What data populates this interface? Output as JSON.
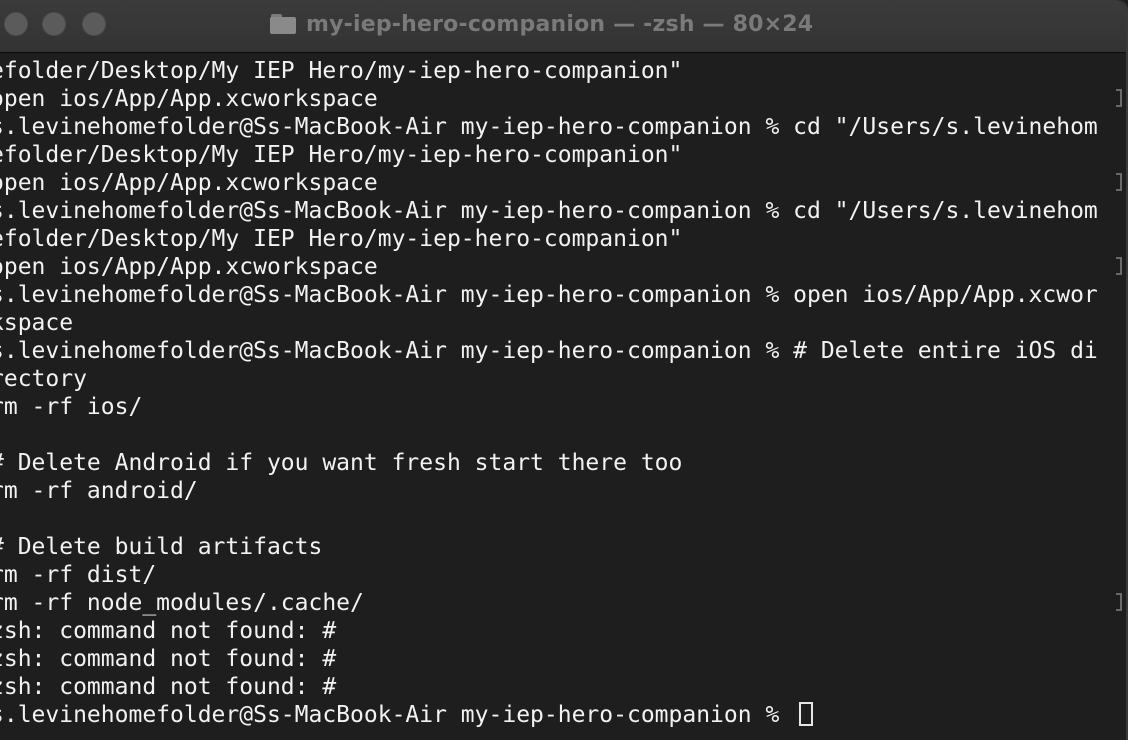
{
  "window": {
    "title": "my-iep-hero-companion — -zsh — 80×24",
    "folder_icon": "folder-icon"
  },
  "terminal": {
    "lines": [
      "efolder/Desktop/My IEP Hero/my-iep-hero-companion\"",
      "open ios/App/App.xcworkspace",
      "s.levinehomefolder@Ss-MacBook-Air my-iep-hero-companion % cd \"/Users/s.levinehom",
      "efolder/Desktop/My IEP Hero/my-iep-hero-companion\"",
      "open ios/App/App.xcworkspace",
      "s.levinehomefolder@Ss-MacBook-Air my-iep-hero-companion % cd \"/Users/s.levinehom",
      "efolder/Desktop/My IEP Hero/my-iep-hero-companion\"",
      "open ios/App/App.xcworkspace",
      "s.levinehomefolder@Ss-MacBook-Air my-iep-hero-companion % open ios/App/App.xcwor",
      "kspace",
      "s.levinehomefolder@Ss-MacBook-Air my-iep-hero-companion % # Delete entire iOS di",
      "rectory",
      "rm -rf ios/",
      "",
      "# Delete Android if you want fresh start there too",
      "rm -rf android/",
      "",
      "# Delete build artifacts",
      "rm -rf dist/",
      "rm -rf node_modules/.cache/",
      "zsh: command not found: #",
      "zsh: command not found: #",
      "zsh: command not found: #",
      "s.levinehomefolder@Ss-MacBook-Air my-iep-hero-companion % "
    ]
  }
}
